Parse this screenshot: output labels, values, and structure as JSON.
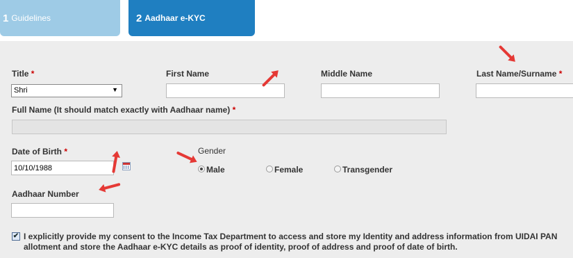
{
  "tabs": [
    {
      "num": "1",
      "label": "Guidelines"
    },
    {
      "num": "2",
      "label": "Aadhaar e-KYC"
    }
  ],
  "form": {
    "title_label": "Title",
    "title_value": "Shri",
    "first_name_label": "First Name",
    "first_name_value": "",
    "middle_name_label": "Middle Name",
    "middle_name_value": "",
    "last_name_label": "Last Name/Surname",
    "last_name_value": "",
    "full_name_label": "Full Name (It should match exactly with Aadhaar name)",
    "full_name_value": "",
    "dob_label": "Date of Birth",
    "dob_value": "10/10/1988",
    "gender_label": "Gender",
    "gender_options": [
      "Male",
      "Female",
      "Transgender"
    ],
    "gender_selected": "Male",
    "aadhaar_label": "Aadhaar Number",
    "aadhaar_value": "",
    "required_mark": "*",
    "consent_checked": true,
    "consent_text": "I explicitly provide my consent to the Income Tax Department to access and store my Identity and address information from UIDAI PAN allotment and store the Aadhaar e-KYC details as proof of identity, proof of address and proof of date of birth."
  },
  "colors": {
    "tab_inactive": "#9ecbe6",
    "tab_active": "#1f7fc1",
    "panel_bg": "#ededed",
    "required": "#cc0000",
    "annotation_arrow": "#e53935"
  },
  "icons": [
    "calendar-icon",
    "checkbox-checked-icon",
    "dropdown-caret-icon",
    "annotation-arrow"
  ]
}
